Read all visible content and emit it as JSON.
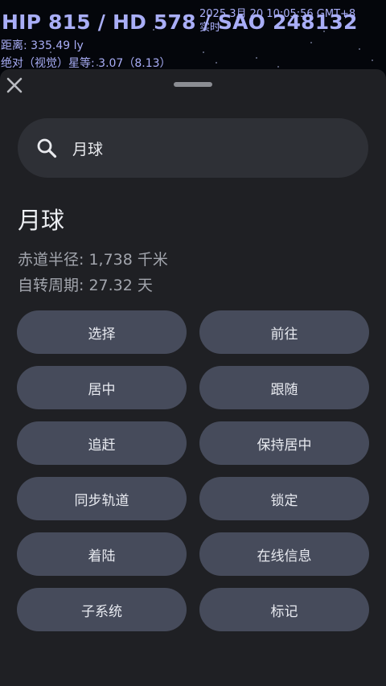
{
  "overlay": {
    "title": "HIP 815 / HD 578 / SAO 248132",
    "distance": "距离: 335.49 ly",
    "magnitude": "绝对（视觉）星等: 3.07（8.13）",
    "datetime": "2025 3月 20 10:05:56 GMT+8",
    "time_mode": "实时"
  },
  "panel": {
    "close_icon": "close-icon",
    "search": {
      "icon": "search-icon",
      "value": "月球",
      "placeholder": ""
    },
    "result": {
      "name": "月球",
      "equatorial_radius": "赤道半径: 1,738 千米",
      "rotation_period": "自转周期: 27.32 天"
    },
    "actions": [
      "选择",
      "前往",
      "居中",
      "跟随",
      "追赶",
      "保持居中",
      "同步轨道",
      "锁定",
      "着陆",
      "在线信息",
      "子系统",
      "标记"
    ]
  },
  "colors": {
    "overlay_text": "#a9aef7",
    "panel_bg": "#1f2024",
    "search_bg": "#2e3036",
    "button_bg": "#464b5b",
    "secondary_text": "#a2a5ad"
  }
}
